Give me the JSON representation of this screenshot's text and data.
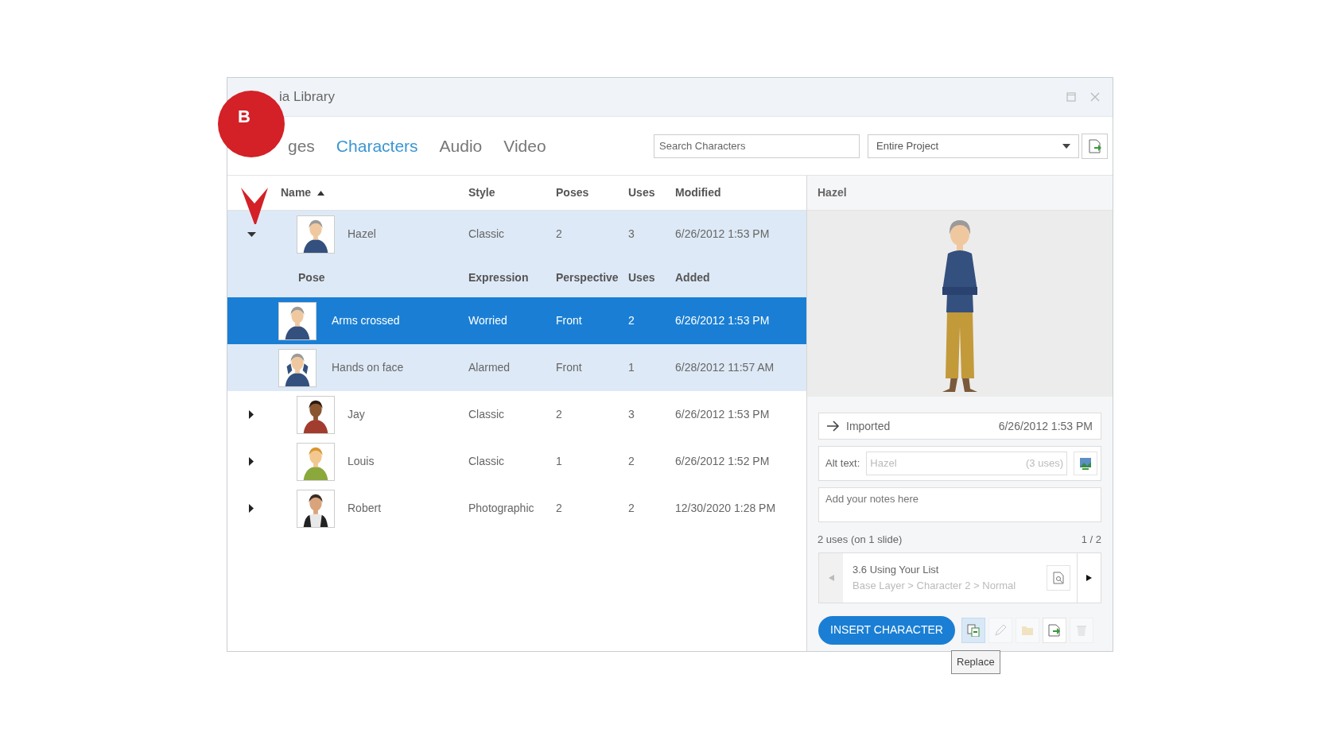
{
  "annotation": {
    "label": "B"
  },
  "window": {
    "title": "ia Library"
  },
  "tabs": [
    {
      "label": "ges",
      "selected": false
    },
    {
      "label": "Characters",
      "selected": true
    },
    {
      "label": "Audio",
      "selected": false
    },
    {
      "label": "Video",
      "selected": false
    }
  ],
  "search": {
    "placeholder": "Search Characters"
  },
  "scope": {
    "value": "Entire Project"
  },
  "table": {
    "columns": [
      {
        "label": "Name",
        "sorted": true
      },
      {
        "label": "Style",
        "sorted": false
      },
      {
        "label": "Poses",
        "sorted": false
      },
      {
        "label": "Uses",
        "sorted": false
      },
      {
        "label": "Modified",
        "sorted": false
      }
    ],
    "rows": [
      {
        "name": "Hazel",
        "style": "Classic",
        "poses": "2",
        "uses": "3",
        "modified": "6/26/2012 1:53 PM",
        "expanded": true,
        "pose_columns": [
          "Pose",
          "Expression",
          "Perspective",
          "Uses",
          "Added"
        ],
        "children": [
          {
            "pose": "Arms crossed",
            "expression": "Worried",
            "perspective": "Front",
            "uses": "2",
            "added": "6/26/2012 1:53 PM",
            "selected": true
          },
          {
            "pose": "Hands on face",
            "expression": "Alarmed",
            "perspective": "Front",
            "uses": "1",
            "added": "6/28/2012 11:57 AM",
            "selected": false
          }
        ]
      },
      {
        "name": "Jay",
        "style": "Classic",
        "poses": "2",
        "uses": "3",
        "modified": "6/26/2012 1:53 PM",
        "expanded": false
      },
      {
        "name": "Louis",
        "style": "Classic",
        "poses": "1",
        "uses": "2",
        "modified": "6/26/2012 1:52 PM",
        "expanded": false
      },
      {
        "name": "Robert",
        "style": "Photographic",
        "poses": "2",
        "uses": "2",
        "modified": "12/30/2020 1:28 PM",
        "expanded": false
      }
    ]
  },
  "detail": {
    "title": "Hazel",
    "imported_label": "Imported",
    "imported_date": "6/26/2012 1:53 PM",
    "alt_label": "Alt text:",
    "alt_placeholder": "Hazel",
    "alt_uses": "(3 uses)",
    "notes_placeholder": "Add your notes here",
    "uses_summary": "2 uses (on 1 slide)",
    "uses_page": "1 / 2",
    "usage": {
      "slide": "3.6 Using Your List",
      "path": "Base Layer > Character 2 > Normal",
      "prev_disabled": true,
      "next_disabled": false
    },
    "insert_button": "INSERT CHARACTER",
    "tools": [
      {
        "kind": "replace",
        "disabled": false,
        "hovered": true
      },
      {
        "kind": "edit",
        "disabled": true,
        "hovered": false
      },
      {
        "kind": "folder",
        "disabled": true,
        "hovered": false
      },
      {
        "kind": "export",
        "disabled": false,
        "hovered": false
      },
      {
        "kind": "delete",
        "disabled": true,
        "hovered": false
      }
    ],
    "tooltip": "Replace"
  }
}
